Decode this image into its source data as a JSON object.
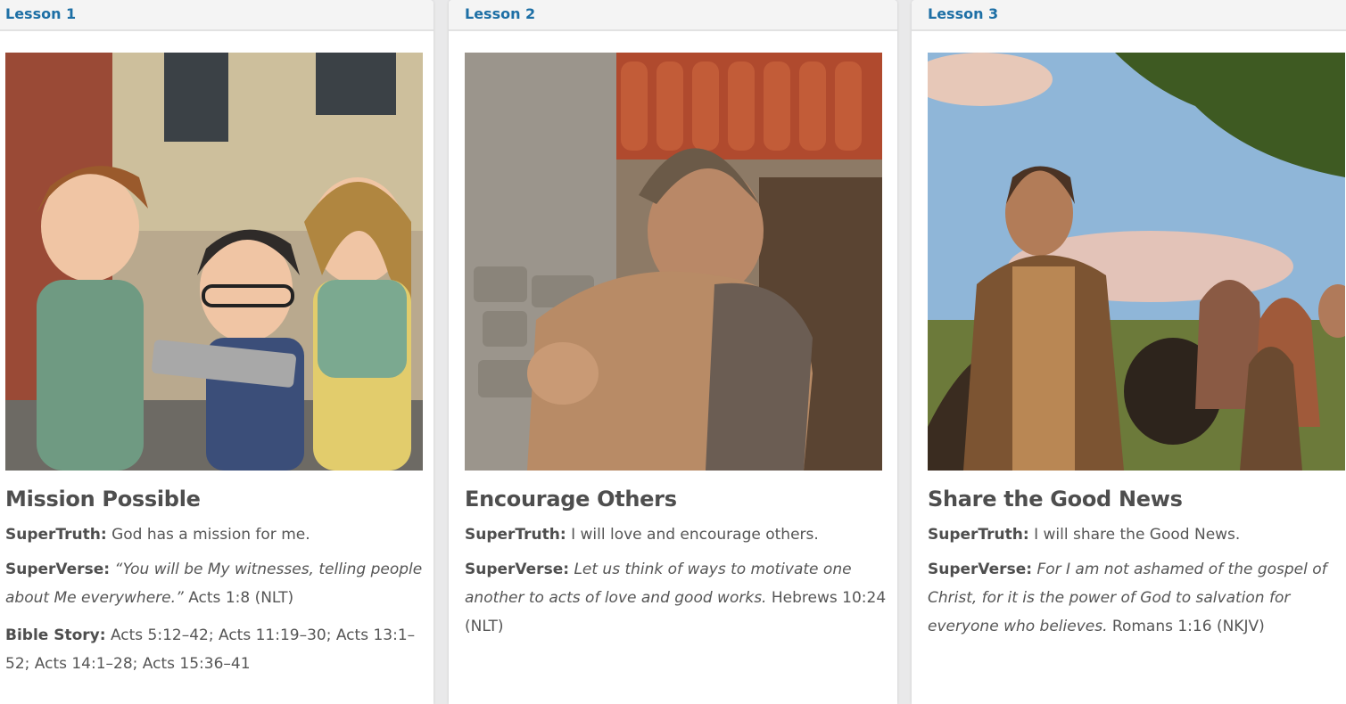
{
  "lessons": [
    {
      "tab": "Lesson 1",
      "title": "Mission Possible",
      "supertruth_label": "SuperTruth:",
      "supertruth": "God has a mission for me.",
      "superverse_label": "SuperVerse:",
      "superverse_text": "“You will be My witnesses, telling people about Me everywhere.”",
      "superverse_ref": "Acts 1:8 (NLT)",
      "story_label": "Bible Story:",
      "story": "Acts 5:12–42; Acts 11:19–30; Acts 13:1–52; Acts 14:1–28; Acts 15:36–41",
      "image": "kids-looking-at-tablet-illustration"
    },
    {
      "tab": "Lesson 2",
      "title": "Encourage Others",
      "supertruth_label": "SuperTruth:",
      "supertruth": "I will love and encourage others.",
      "superverse_label": "SuperVerse:",
      "superverse_text": "Let us think of ways to motivate one another to acts of love and good works.",
      "superverse_ref": "Hebrews 10:24 (NLT)",
      "image": "two-men-embracing-illustration"
    },
    {
      "tab": "Lesson 3",
      "title": "Share the Good News",
      "supertruth_label": "SuperTruth:",
      "supertruth": "I will share the Good News.",
      "superverse_label": "SuperVerse:",
      "superverse_text": "For I am not ashamed of the gospel of Christ, for it is the power of God to salvation for everyone who believes.",
      "superverse_ref": "Romans 1:16 (NKJV)",
      "image": "man-speaking-to-crowd-illustration"
    }
  ],
  "colors": {
    "tab_text": "#1d6fa5",
    "title_text": "#4e4e4e",
    "body_text": "#555555",
    "page_bg": "#e9e9ea"
  }
}
